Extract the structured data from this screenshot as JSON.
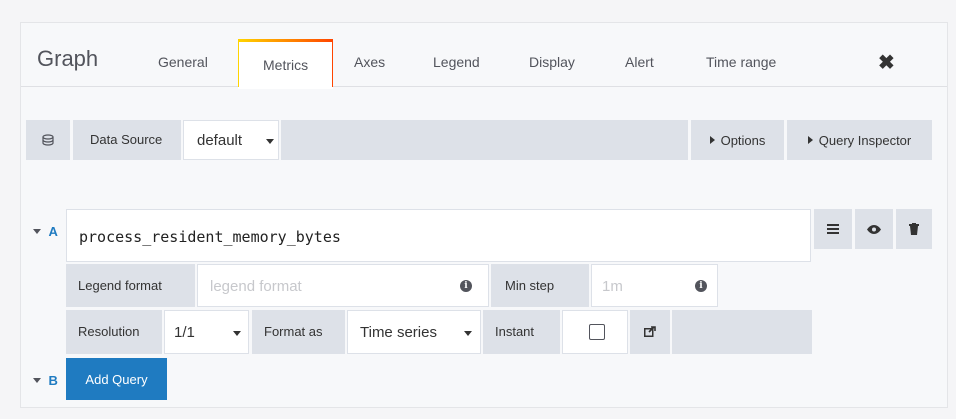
{
  "panel": {
    "title": "Graph",
    "tabs": [
      "General",
      "Metrics",
      "Axes",
      "Legend",
      "Display",
      "Alert",
      "Time range"
    ],
    "active_tab": "Metrics"
  },
  "datasource": {
    "label": "Data Source",
    "value": "default",
    "options_label": "Options",
    "inspector_label": "Query Inspector"
  },
  "query_a": {
    "ref": "A",
    "expression": "process_resident_memory_bytes",
    "legend_format_label": "Legend format",
    "legend_format_placeholder": "legend format",
    "min_step_label": "Min step",
    "min_step_placeholder": "1m",
    "resolution_label": "Resolution",
    "resolution_value": "1/1",
    "format_as_label": "Format as",
    "format_as_value": "Time series",
    "instant_label": "Instant"
  },
  "query_b": {
    "ref": "B",
    "add_label": "Add Query"
  },
  "colors": {
    "accent": "#1f7bc1",
    "active_tab_gradient": [
      "#ffd500",
      "#ff4400"
    ]
  }
}
